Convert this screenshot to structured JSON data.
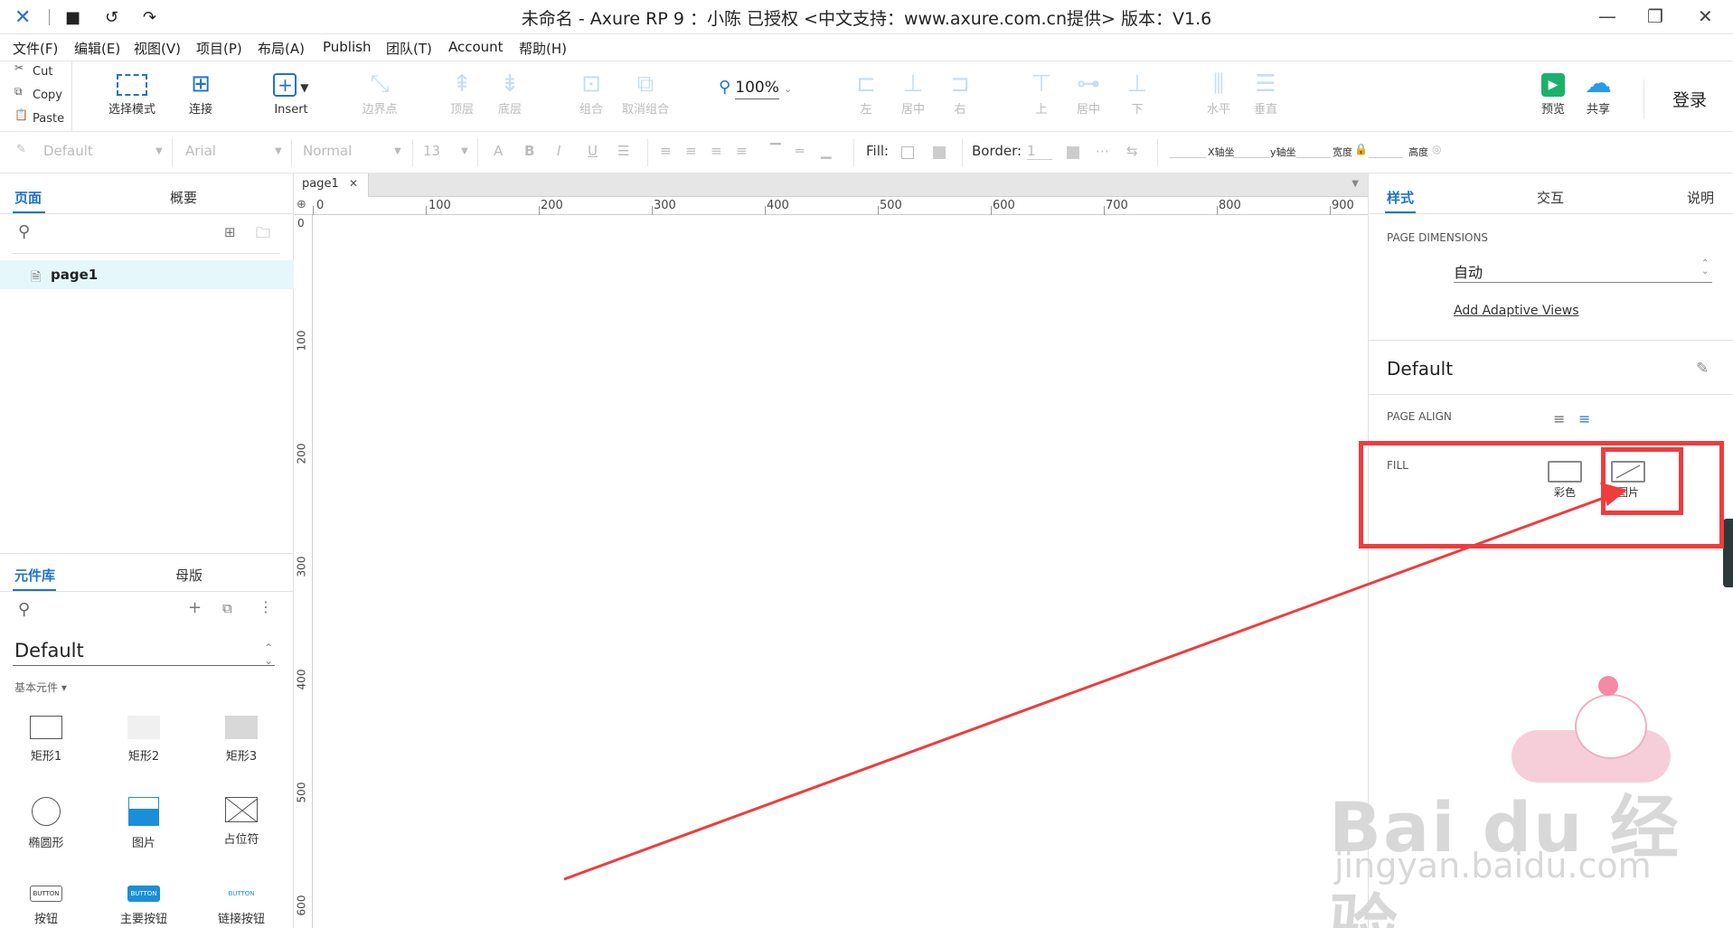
{
  "window": {
    "title": "未命名 - Axure RP 9 ：小陈 已授权    <中文支持：www.axure.com.cn提供> 版本：V1.6"
  },
  "menu": [
    "文件(F)",
    "编辑(E)",
    "视图(V)",
    "项目(P)",
    "布局(A)",
    "Publish",
    "团队(T)",
    "Account",
    "帮助(H)"
  ],
  "clipboard": {
    "cut": "Cut",
    "copy": "Copy",
    "paste": "Paste"
  },
  "toolbar": {
    "select_mode": "选择模式",
    "connect": "连接",
    "insert": "Insert",
    "boundary": "边界点",
    "zoom": "100%",
    "top_layer": "顶层",
    "bottom_layer": "底层",
    "group": "组合",
    "ungroup": "取消组合",
    "align_left": "左",
    "align_center": "居中",
    "align_right": "右",
    "align_top": "上",
    "align_middle": "居中",
    "align_bottom": "下",
    "dist_h": "水平",
    "dist_v": "垂直",
    "preview": "预览",
    "share": "共享",
    "login": "登录"
  },
  "format": {
    "style": "Default",
    "font": "Arial",
    "weight": "Normal",
    "size": "13",
    "fill_label": "Fill:",
    "border_label": "Border:",
    "border_value": "1",
    "x_label": "X轴坐",
    "y_label": "y轴坐",
    "w_label": "宽度",
    "h_label": "高度"
  },
  "pages_panel": {
    "tabs": [
      "页面",
      "概要"
    ],
    "page": "page1"
  },
  "library_panel": {
    "tabs": [
      "元件库",
      "母版"
    ],
    "library": "Default",
    "category": "基本元件",
    "widgets": [
      "矩形1",
      "矩形2",
      "矩形3",
      "椭圆形",
      "图片",
      "占位符",
      "按钮",
      "主要按钮",
      "链接按钮"
    ],
    "button_text": "BUTTON"
  },
  "canvas": {
    "tab": "page1",
    "ruler_h": [
      "0",
      "100",
      "200",
      "300",
      "400",
      "500",
      "600",
      "700",
      "800",
      "900"
    ],
    "ruler_v": [
      "0",
      "100",
      "200",
      "300",
      "400",
      "500",
      "600"
    ]
  },
  "right_panel": {
    "tabs": [
      "样式",
      "交互",
      "说明"
    ],
    "page_dimensions_label": "PAGE DIMENSIONS",
    "page_dimensions_value": "自动",
    "adaptive_link": "Add Adaptive Views",
    "style_name": "Default",
    "page_align_label": "PAGE ALIGN",
    "fill_label": "FILL",
    "fill_color": "彩色",
    "fill_image": "图片"
  },
  "watermark": {
    "brand": "Bai  du 经验",
    "url": "jingyan.baidu.com"
  },
  "colors": {
    "accent": "#1e73c8",
    "annotation": "#f03c3c",
    "selected_row": "#e6f7fb"
  }
}
